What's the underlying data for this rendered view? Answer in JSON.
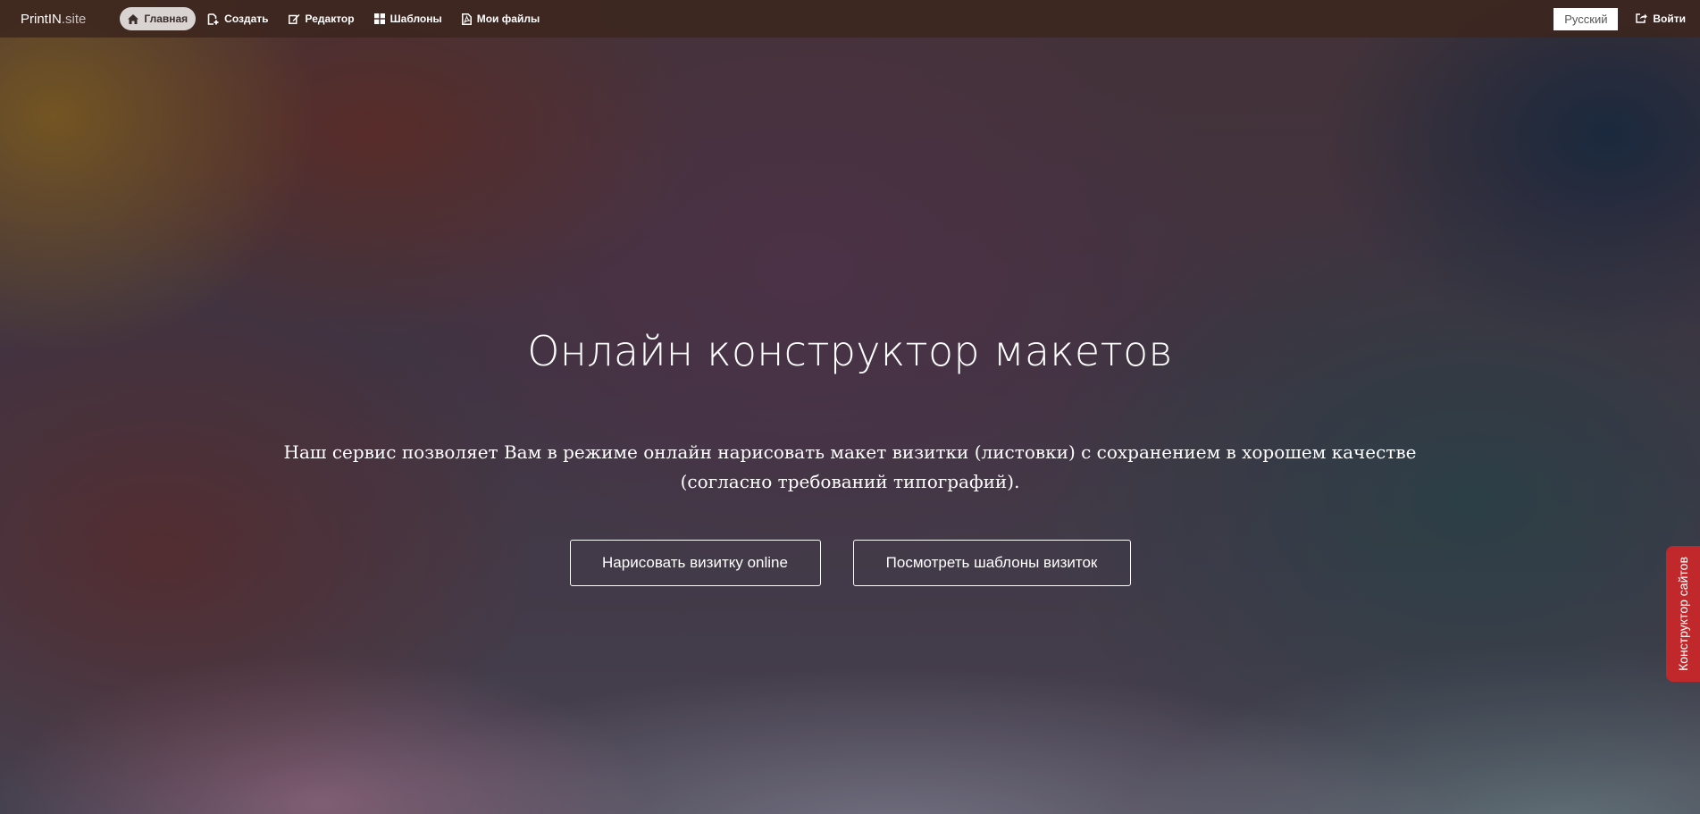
{
  "brand": {
    "name": "PrintIN",
    "suffix": ".site"
  },
  "nav": {
    "items": [
      {
        "label": "Главная",
        "icon": "home-icon",
        "active": true
      },
      {
        "label": "Создать",
        "icon": "new-file-icon",
        "active": false
      },
      {
        "label": "Редактор",
        "icon": "edit-icon",
        "active": false
      },
      {
        "label": "Шаблоны",
        "icon": "grid-icon",
        "active": false
      },
      {
        "label": "Мои файлы",
        "icon": "file-pdf-icon",
        "active": false
      }
    ],
    "language": "Русский",
    "login_label": "Войти",
    "login_icon": "sign-in-icon"
  },
  "hero": {
    "title": "Онлайн конструктор макетов",
    "text": "Наш сервис позволяет Вам в режиме онлайн нарисовать макет визитки (листовки) с сохранением в хорошем качестве (согласно требований типографий).",
    "buttons": {
      "draw_label": "Нарисовать визитку online",
      "templates_label": "Посмотреть шаблоны визиток"
    }
  },
  "side_tab": {
    "label": "Конструктор сайтов",
    "color": "#c0282c"
  },
  "colors": {
    "navbar": "#3c261e",
    "active_pill": "#d9d4d2"
  }
}
